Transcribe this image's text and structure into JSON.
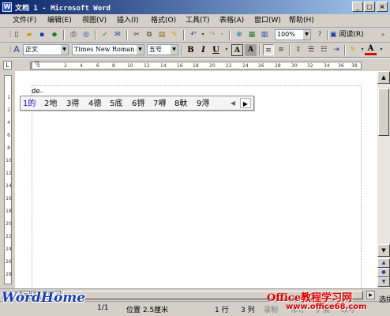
{
  "window": {
    "title": "文档 1 - Microsoft Word",
    "minimize_glyph": "_",
    "maximize_glyph": "□",
    "close_glyph": "×"
  },
  "menu": [
    {
      "label": "文件(F)"
    },
    {
      "label": "编辑(E)"
    },
    {
      "label": "视图(V)"
    },
    {
      "label": "插入(I)"
    },
    {
      "label": "格式(O)"
    },
    {
      "label": "工具(T)"
    },
    {
      "label": "表格(A)"
    },
    {
      "label": "窗口(W)"
    },
    {
      "label": "帮助(H)"
    }
  ],
  "toolbar": {
    "zoom": "100%",
    "read_label": "阅读(R)",
    "style": "正文",
    "font": "Times New Roman",
    "size": "五号",
    "bold": "B",
    "italic": "I",
    "underline": "U",
    "char_a": "A",
    "char_a2": "A",
    "font_color_label": "A"
  },
  "ruler": {
    "h_numbers": [
      "2",
      "2",
      "4",
      "6",
      "8",
      "10",
      "12",
      "14",
      "16",
      "18",
      "20",
      "22",
      "24",
      "26",
      "28",
      "30",
      "32",
      "34",
      "36",
      "38"
    ],
    "v_numbers": [
      "1",
      "2",
      "4",
      "6",
      "8",
      "10",
      "12",
      "14",
      "16",
      "18",
      "20",
      "22",
      "24",
      "26",
      "28",
      "30"
    ]
  },
  "document": {
    "text": "de",
    "paragraph_mark": "↵"
  },
  "ime": {
    "candidates": [
      {
        "num": "1",
        "char": "的"
      },
      {
        "num": "2",
        "char": "地"
      },
      {
        "num": "3",
        "char": "得"
      },
      {
        "num": "4",
        "char": "德"
      },
      {
        "num": "5",
        "char": "底"
      },
      {
        "num": "6",
        "char": "锝"
      },
      {
        "num": "7",
        "char": "嘚"
      },
      {
        "num": "8",
        "char": "軑"
      },
      {
        "num": "9",
        "char": "淂"
      }
    ],
    "prev_glyph": "◀",
    "next_glyph": "▶"
  },
  "status": {
    "page_count": "1/1",
    "position": "位置 2.5厘米",
    "line": "1 行",
    "column": "3 列",
    "record": "录制",
    "revise": "修订",
    "extend": "扩展",
    "overwrite": "改写",
    "lang": "选拼"
  },
  "watermarks": {
    "logo": "WordHome",
    "site_title": "Office教程学习网",
    "site_url": "www.office68.com"
  },
  "colors": {
    "title_start": "#0a246a",
    "title_end": "#a6caf0",
    "chrome": "#d4d0c8",
    "watermark_red": "#e00000",
    "logo_blue": "#1a3fae"
  }
}
